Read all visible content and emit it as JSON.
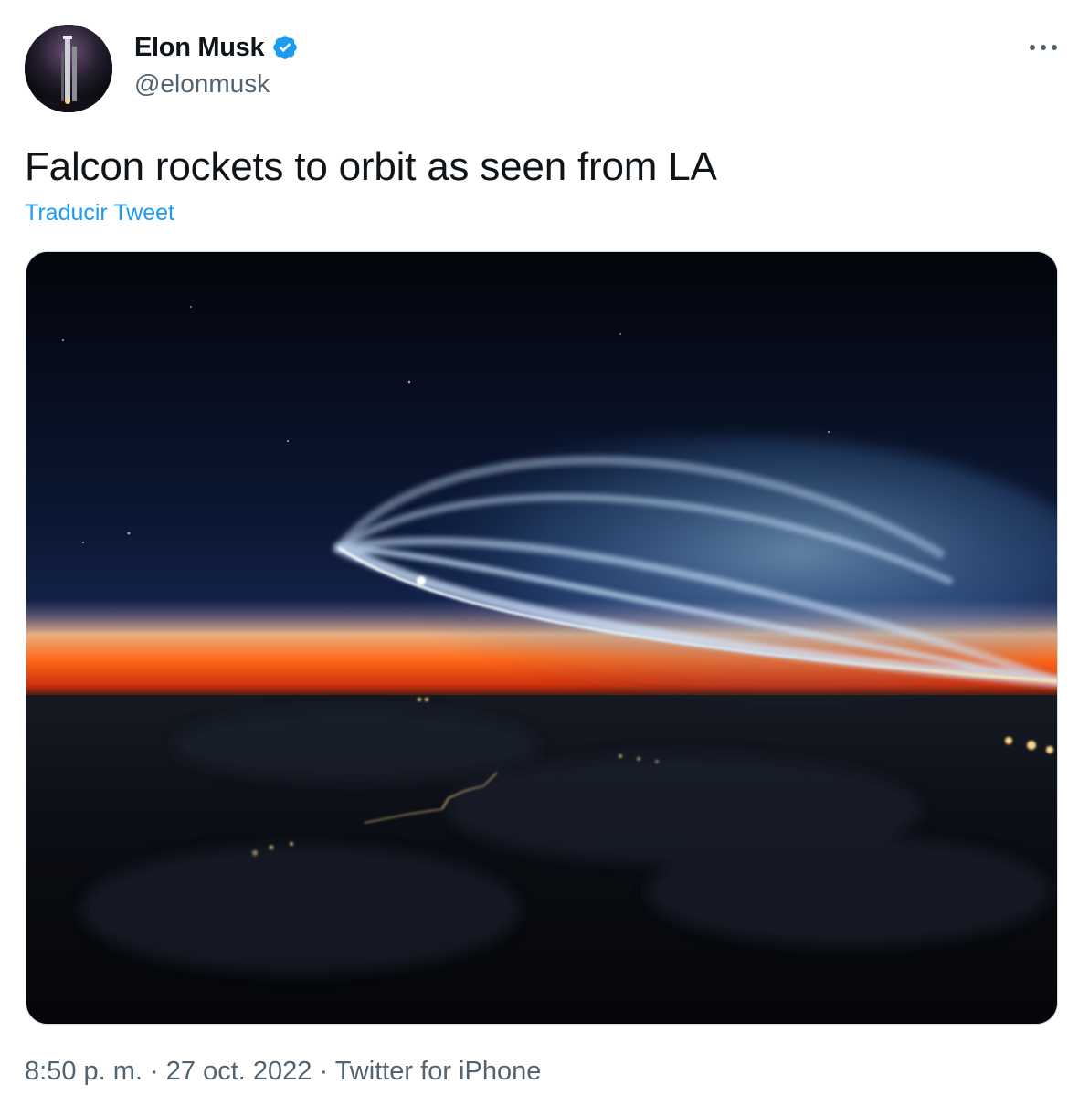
{
  "author": {
    "display_name": "Elon Musk",
    "handle": "@elonmusk",
    "verified": true,
    "avatar_icon": "avatar-rocket-tower-icon"
  },
  "tweet": {
    "text": "Falcon rockets to orbit as seen from LA",
    "translate_label": "Traducir Tweet",
    "media_icon": "photo-rocket-plume-icon"
  },
  "meta": {
    "time": "8:50 p. m.",
    "separator": "·",
    "date": "27 oct. 2022",
    "source": "Twitter for iPhone"
  },
  "icons": {
    "verified": "verified-badge-icon",
    "more": "more-options-icon"
  },
  "colors": {
    "accent": "#1d9bf0",
    "text_primary": "#0f1419",
    "text_secondary": "#536471"
  }
}
